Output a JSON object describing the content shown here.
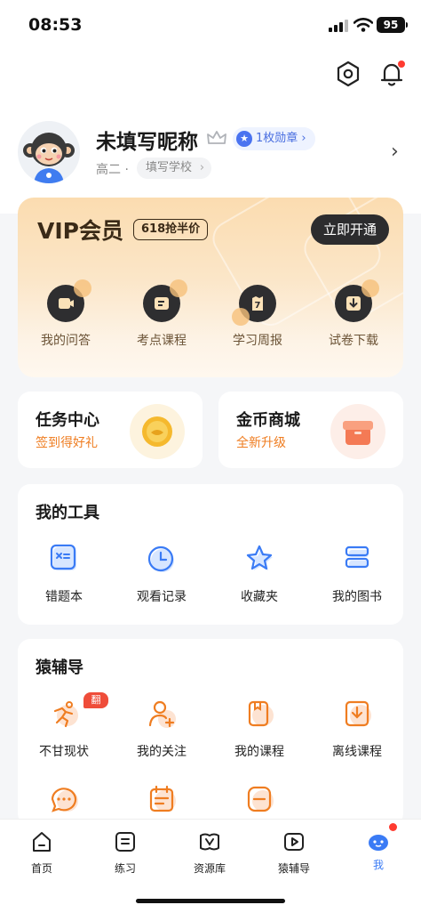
{
  "status_bar": {
    "time": "08:53",
    "battery": "95"
  },
  "profile": {
    "nickname": "未填写昵称",
    "badge_label": "1枚勋章",
    "grade": "高二 ·",
    "school": "填写学校"
  },
  "vip": {
    "title": "VIP会员",
    "promo": "618抢半价",
    "open_button": "立即开通",
    "items": [
      {
        "label": "我的问答",
        "icon": "qa-icon"
      },
      {
        "label": "考点课程",
        "icon": "course-icon"
      },
      {
        "label": "学习周报",
        "icon": "weekly-report-icon",
        "icon_text": "7"
      },
      {
        "label": "试卷下载",
        "icon": "download-icon"
      }
    ]
  },
  "task_center": {
    "title": "任务中心",
    "subtitle": "签到得好礼"
  },
  "coin_mall": {
    "title": "金币商城",
    "subtitle": "全新升级"
  },
  "tools": {
    "title": "我的工具",
    "items": [
      {
        "label": "错题本",
        "icon": "mistake-book-icon"
      },
      {
        "label": "观看记录",
        "icon": "clock-icon"
      },
      {
        "label": "收藏夹",
        "icon": "star-icon"
      },
      {
        "label": "我的图书",
        "icon": "books-icon"
      }
    ]
  },
  "fudao": {
    "title": "猿辅导",
    "flag": "翻盘",
    "items": [
      {
        "label": "不甘现状",
        "icon": "runner-icon"
      },
      {
        "label": "我的关注",
        "icon": "follow-user-icon"
      },
      {
        "label": "我的课程",
        "icon": "my-course-icon"
      },
      {
        "label": "离线课程",
        "icon": "offline-course-icon"
      }
    ]
  },
  "bottom_nav": [
    {
      "label": "首页",
      "icon": "home-icon"
    },
    {
      "label": "练习",
      "icon": "practice-icon"
    },
    {
      "label": "资源库",
      "icon": "library-icon"
    },
    {
      "label": "猿辅导",
      "icon": "play-icon"
    },
    {
      "label": "我",
      "icon": "me-icon",
      "active": true
    }
  ],
  "colors": {
    "accent_blue": "#3a7bf5",
    "accent_orange": "#ef7d21",
    "vip_gold": "#fbdcb0"
  }
}
